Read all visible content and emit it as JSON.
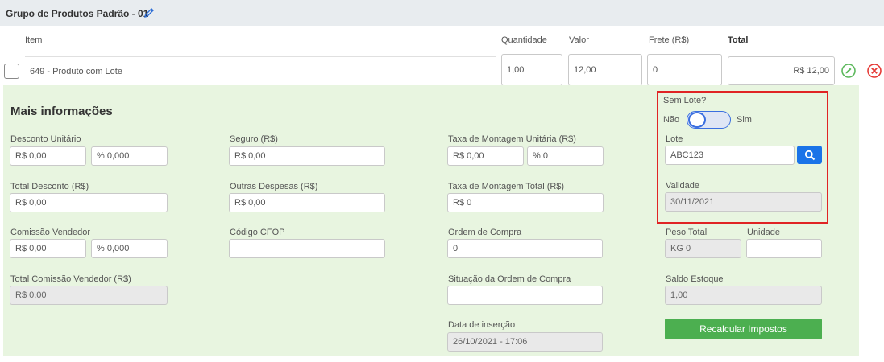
{
  "header": {
    "title": "Grupo de Produtos Padrão - 01"
  },
  "columns": {
    "item": "Item",
    "quantidade": "Quantidade",
    "valor": "Valor",
    "frete": "Frete (R$)",
    "total": "Total"
  },
  "row": {
    "item": "649 - Produto com Lote",
    "quantidade": "1,00",
    "valor": "12,00",
    "frete": "0",
    "total": "R$ 12,00"
  },
  "panel": {
    "title": "Mais informações",
    "desconto_unitario": {
      "label": "Desconto Unitário",
      "valor": "R$ 0,00",
      "percent": "% 0,000"
    },
    "total_desconto": {
      "label": "Total Desconto (R$)",
      "valor": "R$ 0,00"
    },
    "comissao_vendedor": {
      "label": "Comissão Vendedor",
      "valor": "R$ 0,00",
      "percent": "% 0,000"
    },
    "total_comissao": {
      "label": "Total Comissão Vendedor (R$)",
      "valor": "R$ 0,00"
    },
    "seguro": {
      "label": "Seguro (R$)",
      "valor": "R$ 0,00"
    },
    "outras_despesas": {
      "label": "Outras Despesas (R$)",
      "valor": "R$ 0,00"
    },
    "codigo_cfop": {
      "label": "Código CFOP",
      "valor": ""
    },
    "taxa_montagem_unitaria": {
      "label": "Taxa de Montagem Unitária (R$)",
      "valor": "R$ 0,00",
      "percent": "% 0"
    },
    "taxa_montagem_total": {
      "label": "Taxa de Montagem Total (R$)",
      "valor": "R$ 0"
    },
    "ordem_compra": {
      "label": "Ordem de Compra",
      "valor": "0"
    },
    "situacao_ordem": {
      "label": "Situação da Ordem de Compra",
      "valor": ""
    },
    "data_insercao": {
      "label": "Data de inserção",
      "valor": "26/10/2021 - 17:06"
    },
    "sem_lote": {
      "label": "Sem Lote?",
      "nao": "Não",
      "sim": "Sim",
      "checked": false
    },
    "lote": {
      "label": "Lote",
      "valor": "ABC123"
    },
    "validade": {
      "label": "Validade",
      "valor": "30/11/2021"
    },
    "peso_total": {
      "label": "Peso Total",
      "valor": "KG 0"
    },
    "unidade": {
      "label": "Unidade",
      "valor": ""
    },
    "saldo_estoque": {
      "label": "Saldo Estoque",
      "valor": "1,00"
    },
    "recalcular": "Recalcular Impostos"
  },
  "colors": {
    "accent": "#1a73e8",
    "panel_bg": "#e8f5e0",
    "button_green": "#4caf50",
    "highlight_red": "#e02424",
    "remove_red": "#e53935"
  }
}
